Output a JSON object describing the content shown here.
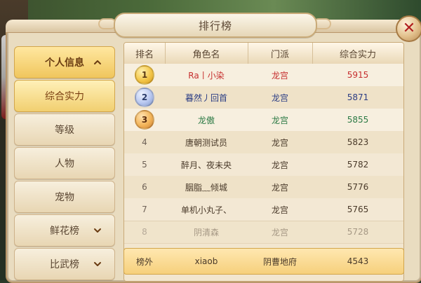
{
  "window": {
    "title": "排行榜",
    "close_symbol": "✕"
  },
  "sidebar": {
    "items": [
      {
        "label": "个人信息",
        "kind": "header",
        "chevron": "up"
      },
      {
        "label": "综合实力",
        "kind": "subitem",
        "active": true
      },
      {
        "label": "等级",
        "kind": "subitem"
      },
      {
        "label": "人物",
        "kind": "subitem"
      },
      {
        "label": "宠物",
        "kind": "subitem"
      },
      {
        "label": "鲜花榜",
        "kind": "group",
        "chevron": "down"
      },
      {
        "label": "比武榜",
        "kind": "group",
        "chevron": "down"
      }
    ]
  },
  "table": {
    "headers": [
      "排名",
      "角色名",
      "门派",
      "综合实力"
    ],
    "rows": [
      {
        "rank": "1",
        "name": "Ra丨小染",
        "school": "龙宫",
        "score": "5915",
        "medal": "gold",
        "color": "red"
      },
      {
        "rank": "2",
        "name": "暮然丿回首",
        "school": "龙宫",
        "score": "5871",
        "medal": "silver",
        "color": "blue"
      },
      {
        "rank": "3",
        "name": "龙傲",
        "school": "龙宫",
        "score": "5855",
        "medal": "bronze",
        "color": "green"
      },
      {
        "rank": "4",
        "name": "唐朝测试员",
        "school": "龙宫",
        "score": "5823"
      },
      {
        "rank": "5",
        "name": "醉月、夜未央",
        "school": "龙宫",
        "score": "5782"
      },
      {
        "rank": "6",
        "name": "胭脂﹏倾城",
        "school": "龙宫",
        "score": "5776"
      },
      {
        "rank": "7",
        "name": "单机小丸子、",
        "school": "龙宫",
        "score": "5765"
      },
      {
        "rank": "8",
        "name": "阴清森",
        "school": "龙宫",
        "score": "5728",
        "faded": true
      }
    ],
    "footer": {
      "label": "榜外",
      "name": "xiaob",
      "school": "阴曹地府",
      "score": "4543"
    }
  },
  "colors": {
    "accent_gold": "#f0c65d",
    "panel_bg": "#e9dcc0",
    "red_text": "#c62f2f",
    "blue_text": "#2b3d84",
    "green_text": "#2c7a45"
  }
}
